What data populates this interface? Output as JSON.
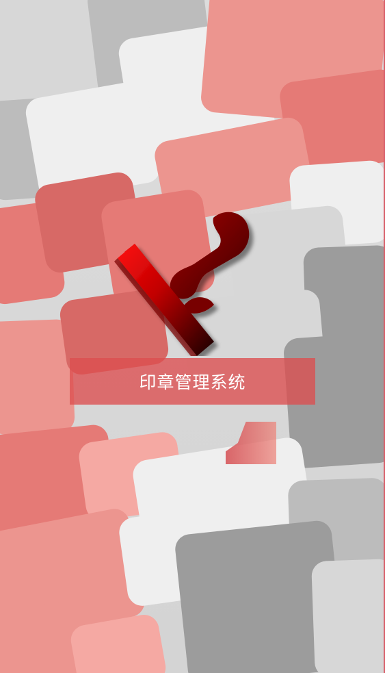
{
  "app": {
    "title": "印章管理系统"
  },
  "visual": {
    "logo_icon": "stamp-icon",
    "accent_colors": {
      "title_band": "#dc4e50",
      "stamp_dark": "#4e0004",
      "stamp_red": "#ff1a1a"
    }
  }
}
